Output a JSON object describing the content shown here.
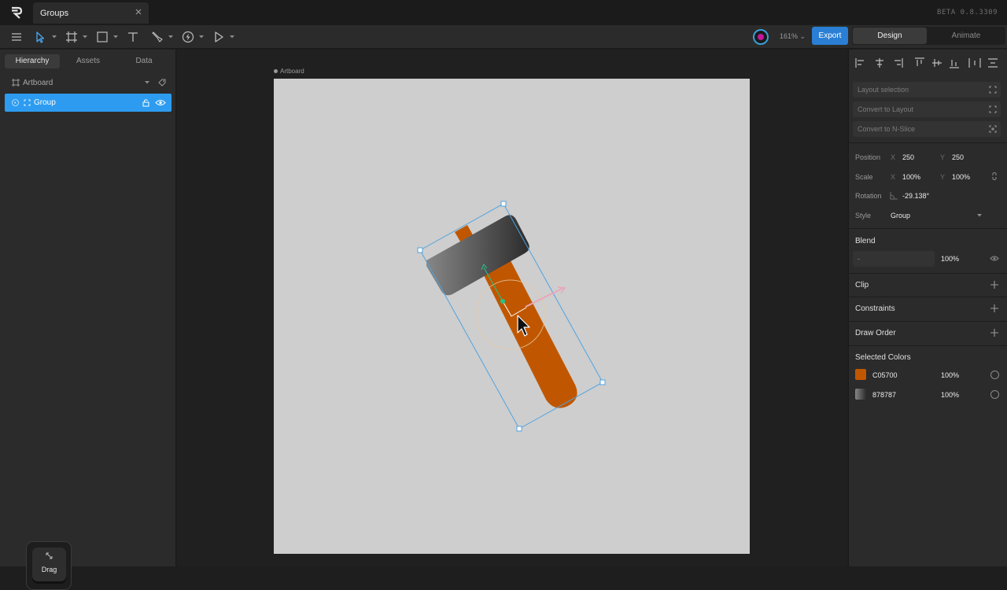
{
  "window": {
    "doc_title": "Groups",
    "beta_label": "BETA 0.8.3309"
  },
  "toolbar": {
    "zoom_label": "161% ⌄",
    "export_label": "Export",
    "mode_design": "Design",
    "mode_animate": "Animate"
  },
  "left_panel": {
    "tabs": [
      "Hierarchy",
      "Assets",
      "Data"
    ],
    "tree": {
      "artboard_label": "Artboard",
      "group_label": "Group"
    },
    "drag_label": "Drag"
  },
  "canvas": {
    "artboard_label": "Artboard"
  },
  "right_panel": {
    "layout_selection": "Layout selection",
    "convert_layout": "Convert to Layout",
    "convert_nslice": "Convert to N-Slice",
    "position": {
      "label": "Position",
      "x_axis": "X",
      "x": "250",
      "y_axis": "Y",
      "y": "250"
    },
    "scale": {
      "label": "Scale",
      "x_axis": "X",
      "x": "100%",
      "y_axis": "Y",
      "y": "100%"
    },
    "rotation": {
      "label": "Rotation",
      "value": "-29.138°"
    },
    "style": {
      "label": "Style",
      "value": "Group"
    },
    "blend": {
      "title": "Blend",
      "mode": "-",
      "opacity": "100%"
    },
    "clip_title": "Clip",
    "constraints_title": "Constraints",
    "draw_order_title": "Draw Order",
    "selected_colors": {
      "title": "Selected Colors",
      "items": [
        {
          "hex": "C05700",
          "opacity": "100%",
          "color": "#C05700"
        },
        {
          "hex": "878787",
          "opacity": "100%",
          "color": "#878787"
        }
      ]
    }
  },
  "colors": {
    "accent": "#2d9cf0",
    "selection": "#4fa3e0",
    "handle_color": "#C05700",
    "head_color": "#878787"
  }
}
